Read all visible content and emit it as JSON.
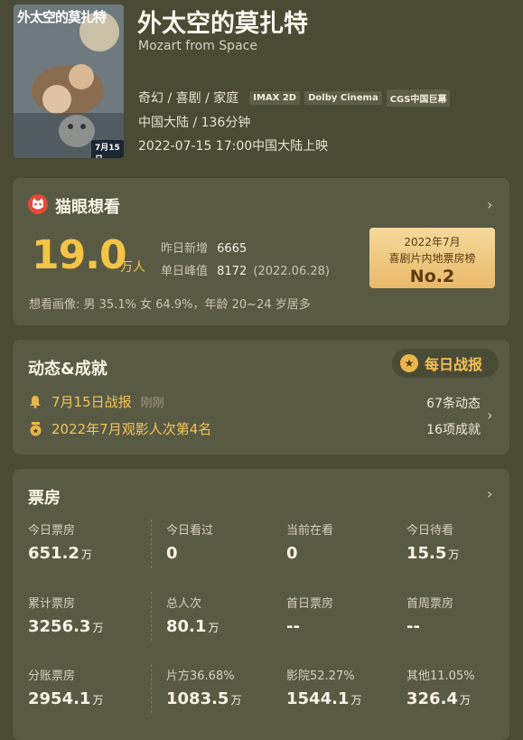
{
  "movie": {
    "poster_title": "外太空的莫扎特",
    "poster_date": "7月15日",
    "title": "外太空的莫扎特",
    "subtitle": "Mozart from Space",
    "genres": "奇幻 / 喜剧 / 家庭",
    "badges": [
      "IMAX 2D",
      "Dolby Cinema",
      "CGS中国巨幕"
    ],
    "region_duration": "中国大陆 / 136分钟",
    "release": "2022-07-15 17:00中国大陆上映"
  },
  "maoyan": {
    "label": "猫眼想看",
    "wish_count": "19.0",
    "wish_unit": "万人",
    "yesterday_label": "昨日新增",
    "yesterday_value": "6665",
    "peak_label": "单日峰值",
    "peak_value": "8172",
    "peak_date": "(2022.06.28)",
    "profile": "想看画像: 男 35.1%   女 64.9%，年龄 20~24 岁居多",
    "rank_line1": "2022年7月",
    "rank_line2": "喜剧片内地票房榜",
    "rank_line3": "No.2"
  },
  "news": {
    "title": "动态&成就",
    "daily_button": "每日战报",
    "line1": "7月15日战报",
    "line1_time": "刚刚",
    "line2": "2022年7月观影人次第4名",
    "count1": "67条动态",
    "count2": "16项成就"
  },
  "boxoffice": {
    "title": "票房",
    "rows": [
      [
        {
          "label": "今日票房",
          "value": "651.2",
          "unit": "万"
        },
        {
          "label": "今日看过",
          "value": "0",
          "unit": ""
        },
        {
          "label": "当前在看",
          "value": "0",
          "unit": ""
        },
        {
          "label": "今日待看",
          "value": "15.5",
          "unit": "万"
        }
      ],
      [
        {
          "label": "累计票房",
          "value": "3256.3",
          "unit": "万"
        },
        {
          "label": "总人次",
          "value": "80.1",
          "unit": "万"
        },
        {
          "label": "首日票房",
          "value": "--",
          "unit": ""
        },
        {
          "label": "首周票房",
          "value": "--",
          "unit": ""
        }
      ],
      [
        {
          "label": "分账票房",
          "value": "2954.1",
          "unit": "万"
        },
        {
          "label": "片方36.68%",
          "value": "1083.5",
          "unit": "万"
        },
        {
          "label": "影院52.27%",
          "value": "1544.1",
          "unit": "万"
        },
        {
          "label": "其他11.05%",
          "value": "326.4",
          "unit": "万"
        }
      ]
    ]
  },
  "colors": {
    "background": "#4a4b34",
    "card": "#595a44",
    "accent": "#f4c447"
  },
  "icons": [
    "maoyan-cat-icon",
    "chevron-right-icon",
    "medal-icon",
    "bell-icon",
    "trophy-icon"
  ]
}
